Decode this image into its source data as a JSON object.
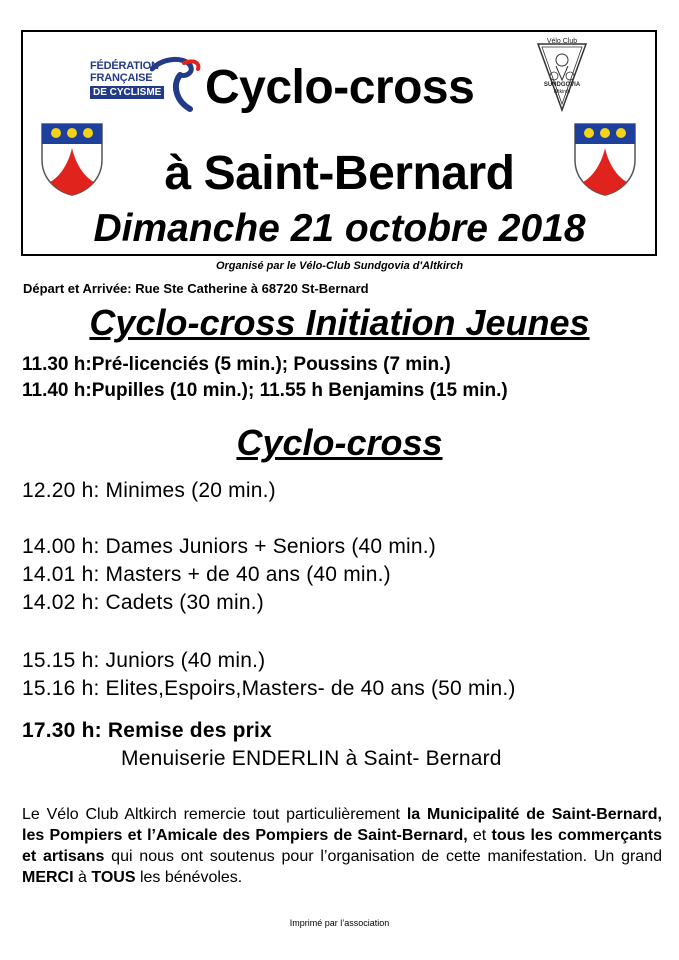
{
  "header": {
    "ffc_logo": {
      "line1": "FÉDÉRATION",
      "line2": "FRANÇAISE",
      "bar": "DE CYCLISME"
    },
    "title": "Cyclo-cross",
    "subtitle": "à Saint-Bernard",
    "date": "Dimanche 21 octobre 2018",
    "club_logo": {
      "top": "Vélo Club",
      "name": "SUNDGOVIA",
      "city": "Altkirch"
    },
    "colors": {
      "shield_blue": "#1f3f9c",
      "shield_red": "#e0231c",
      "shield_gold": "#f2d31a",
      "ffc_blue": "#233a86"
    }
  },
  "organizer": "Organisé par le Vélo-Club Sundgovia d'Altkirch",
  "start_finish": "Départ et Arrivée: Rue Ste Catherine à  68720 St-Bernard",
  "youth": {
    "heading": "Cyclo-cross Initiation Jeunes",
    "lines": [
      "11.30 h:Pré-licenciés (5 min.); Poussins (7 min.)",
      "11.40 h:Pupilles (10 min.); 11.55 h Benjamins (15 min.)"
    ]
  },
  "main": {
    "heading": "Cyclo-cross",
    "schedule": [
      "12.20 h: Minimes (20 min.)",
      "14.00 h: Dames Juniors + Seniors (40 min.)",
      "14.01 h: Masters + de 40 ans (40 min.)",
      "14.02 h: Cadets (30 min.)",
      "15.15 h: Juniors (40 min.)",
      "15.16 h: Elites,Espoirs,Masters- de 40 ans (50 min.)",
      "17.30 h: Remise des prix"
    ],
    "prize_location": "Menuiserie ENDERLIN à Saint- Bernard"
  },
  "thanks": {
    "p1": "Le Vélo Club Altkirch remercie tout particulièrement ",
    "b1": "la Municipalité de Saint-Bernard, les Pompiers et l’Amicale des Pompiers de Saint-Bernard,",
    "p2": " et ",
    "b2": "tous les commerçants et artisans",
    "p3": " qui nous ont soutenus pour l’organisation de cette manifestation. Un grand ",
    "b3": "MERCI",
    "p4": " à ",
    "b4": "TOUS",
    "p5": " les bénévoles."
  },
  "footer": "Imprimé par l’association"
}
